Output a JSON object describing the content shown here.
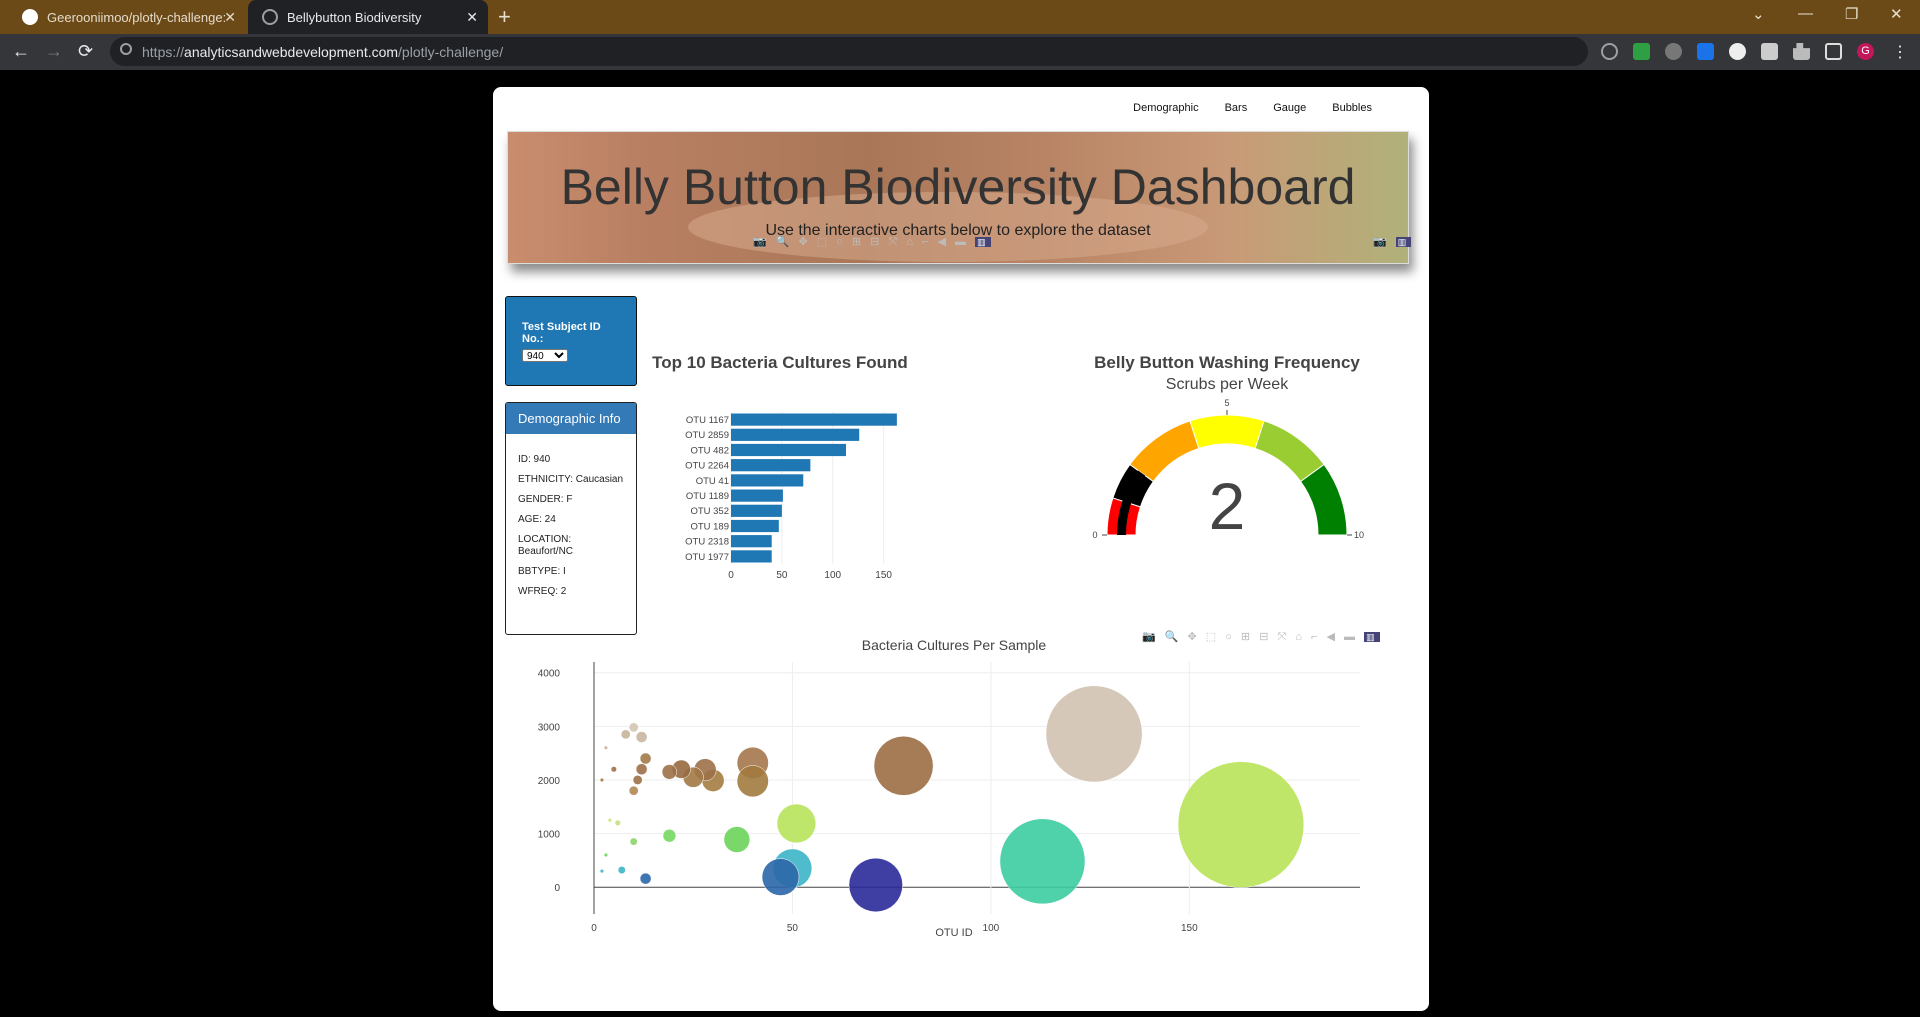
{
  "browser": {
    "tabs": [
      {
        "title": "Geerooniimoo/plotly-challenge: "
      },
      {
        "title": "Bellybutton Biodiversity"
      }
    ],
    "url_prefix": "https://",
    "url_host": "analyticsandwebdevelopment.com",
    "url_path": "/plotly-challenge/"
  },
  "nav": [
    "Demographic",
    "Bars",
    "Gauge",
    "Bubbles"
  ],
  "header": {
    "title": "Belly Button Biodiversity Dashboard",
    "subtitle": "Use the interactive charts below to explore the dataset"
  },
  "selector": {
    "label": "Test Subject ID No.:",
    "selected": "940"
  },
  "demographic": {
    "heading": "Demographic Info",
    "lines": [
      "ID: 940",
      "ETHNICITY: Caucasian",
      "GENDER: F",
      "AGE: 24",
      "LOCATION: Beaufort/NC",
      "BBTYPE: I",
      "WFREQ: 2"
    ]
  },
  "chart_data": [
    {
      "type": "bar",
      "orientation": "horizontal",
      "title": "Top 10 Bacteria Cultures Found",
      "categories": [
        "OTU 1167",
        "OTU 2859",
        "OTU 482",
        "OTU 2264",
        "OTU 41",
        "OTU 1189",
        "OTU 352",
        "OTU 189",
        "OTU 2318",
        "OTU 1977"
      ],
      "values": [
        163,
        126,
        113,
        78,
        71,
        51,
        50,
        47,
        40,
        40
      ],
      "xticks": [
        0,
        50,
        100,
        150
      ],
      "xlim": [
        0,
        170
      ],
      "color": "#1f77b4"
    },
    {
      "type": "gauge",
      "title": "Belly Button Washing Frequency",
      "subtitle": "Scrubs per Week",
      "value": 2,
      "range": [
        0,
        10
      ],
      "tick_labels": [
        "0",
        "5",
        "10"
      ],
      "steps": [
        {
          "from": 0,
          "to": 1,
          "color": "#ff0000"
        },
        {
          "from": 1,
          "to": 2,
          "color": "#000000"
        },
        {
          "from": 2,
          "to": 4,
          "color": "#ffa500"
        },
        {
          "from": 4,
          "to": 6,
          "color": "#ffff00"
        },
        {
          "from": 6,
          "to": 8,
          "color": "#9acd32"
        },
        {
          "from": 8,
          "to": 10,
          "color": "#008000"
        }
      ]
    },
    {
      "type": "scatter",
      "title": "Bacteria Cultures Per Sample",
      "xlabel": "OTU ID",
      "xticks": [
        0,
        50,
        100,
        150
      ],
      "yticks": [
        0,
        1000,
        2000,
        3000,
        4000
      ],
      "xlim": [
        0,
        193
      ],
      "ylim": [
        -500,
        4200
      ],
      "points": [
        {
          "x": 163,
          "y": 1167,
          "r": 34,
          "color": "#b8e358"
        },
        {
          "x": 126,
          "y": 2859,
          "r": 26,
          "color": "#d2c2b0"
        },
        {
          "x": 113,
          "y": 482,
          "r": 23,
          "color": "#3ccca0"
        },
        {
          "x": 78,
          "y": 2264,
          "r": 16,
          "color": "#9c6e45"
        },
        {
          "x": 71,
          "y": 41,
          "r": 14.5,
          "color": "#2a2a99"
        },
        {
          "x": 51,
          "y": 1189,
          "r": 10.5,
          "color": "#b6e35a"
        },
        {
          "x": 50,
          "y": 352,
          "r": 10.5,
          "color": "#3cb5c8"
        },
        {
          "x": 47,
          "y": 189,
          "r": 10,
          "color": "#2a66a8"
        },
        {
          "x": 40,
          "y": 2318,
          "r": 8.5,
          "color": "#a5774c"
        },
        {
          "x": 40,
          "y": 1977,
          "r": 8.5,
          "color": "#a27a3e"
        },
        {
          "x": 36,
          "y": 889,
          "r": 7,
          "color": "#6bd35a"
        },
        {
          "x": 30,
          "y": 1990,
          "r": 6,
          "color": "#a47c40"
        },
        {
          "x": 28,
          "y": 2190,
          "r": 6,
          "color": "#9c7148"
        },
        {
          "x": 25,
          "y": 2050,
          "r": 5.5,
          "color": "#a27944"
        },
        {
          "x": 22,
          "y": 2200,
          "r": 5,
          "color": "#96693f"
        },
        {
          "x": 19,
          "y": 2150,
          "r": 4,
          "color": "#9c7148"
        },
        {
          "x": 19,
          "y": 960,
          "r": 3.5,
          "color": "#75d860"
        },
        {
          "x": 13,
          "y": 160,
          "r": 3,
          "color": "#2a66a8"
        },
        {
          "x": 13,
          "y": 2400,
          "r": 3,
          "color": "#a27a48"
        },
        {
          "x": 12,
          "y": 2200,
          "r": 3,
          "color": "#9c7148"
        },
        {
          "x": 11,
          "y": 2000,
          "r": 2.5,
          "color": "#9c7148"
        },
        {
          "x": 10,
          "y": 1800,
          "r": 2.5,
          "color": "#b08a54"
        },
        {
          "x": 10,
          "y": 850,
          "r": 2,
          "color": "#8cd46b"
        },
        {
          "x": 12,
          "y": 2800,
          "r": 3,
          "color": "#c9b7a0"
        },
        {
          "x": 10,
          "y": 2980,
          "r": 2.5,
          "color": "#d3c5b2"
        },
        {
          "x": 8,
          "y": 2850,
          "r": 2.5,
          "color": "#c7b59a"
        },
        {
          "x": 7,
          "y": 320,
          "r": 2,
          "color": "#3cb5c8"
        },
        {
          "x": 6,
          "y": 1200,
          "r": 1.5,
          "color": "#c3e07a"
        },
        {
          "x": 5,
          "y": 2200,
          "r": 1.5,
          "color": "#9c7148"
        },
        {
          "x": 4,
          "y": 1250,
          "r": 1,
          "color": "#c7e36a"
        },
        {
          "x": 3,
          "y": 2600,
          "r": 1,
          "color": "#c7b59a"
        },
        {
          "x": 3,
          "y": 600,
          "r": 1,
          "color": "#6bd35a"
        },
        {
          "x": 2,
          "y": 300,
          "r": 1,
          "color": "#3cb5c8"
        },
        {
          "x": 2,
          "y": 2000,
          "r": 1,
          "color": "#a27a3e"
        }
      ]
    }
  ]
}
